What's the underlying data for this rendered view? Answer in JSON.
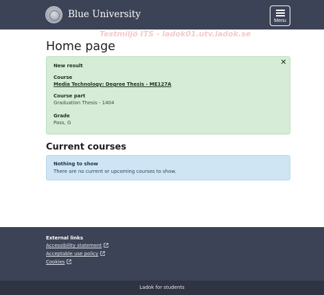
{
  "header": {
    "brand": "Blue University",
    "menu_label": "Menu",
    "watermark": "Testmiljö ITS - ladok01.utv.ladok.se"
  },
  "page": {
    "title": "Home page"
  },
  "new_result": {
    "heading": "New result",
    "close_symbol": "✕",
    "course_label": "Course",
    "course_link": "Media Technology: Degree Thesis - ME127A",
    "course_part_label": "Course part",
    "course_part_value": "Graduation Thesis - 1404",
    "grade_label": "Grade",
    "grade_value": "Pass, G"
  },
  "current_courses": {
    "title": "Current courses",
    "empty_heading": "Nothing to show",
    "empty_text": "There are no current or upcoming courses to show."
  },
  "footer": {
    "title": "External links",
    "links": [
      "Accessibility statement",
      "Acceptable use policy",
      "Cookies"
    ]
  },
  "bottombar": {
    "label": "Ladok for students"
  },
  "colors": {
    "header_bg": "#3c4356",
    "success_bg": "#d6ecd6",
    "info_bg": "#cfe5f3",
    "bottombar_bg": "#2f3442"
  }
}
